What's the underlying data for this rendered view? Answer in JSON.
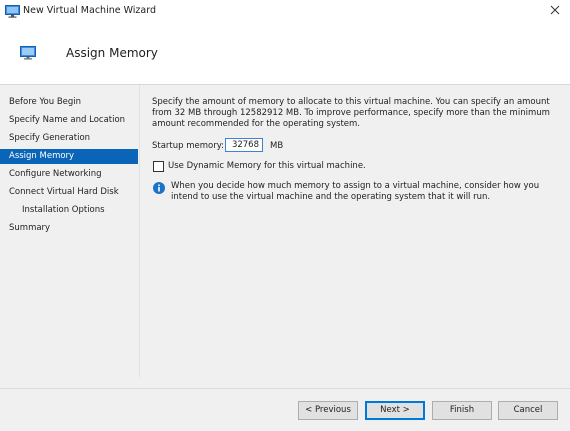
{
  "window": {
    "title": "New Virtual Machine Wizard"
  },
  "header": {
    "title": "Assign Memory"
  },
  "nav": {
    "items": [
      {
        "label": "Before You Begin"
      },
      {
        "label": "Specify Name and Location"
      },
      {
        "label": "Specify Generation"
      },
      {
        "label": "Assign Memory",
        "active": true
      },
      {
        "label": "Configure Networking"
      },
      {
        "label": "Connect Virtual Hard Disk"
      },
      {
        "label": "Installation Options",
        "indent": true
      },
      {
        "label": "Summary"
      }
    ]
  },
  "content": {
    "description": "Specify the amount of memory to allocate to this virtual machine. You can specify an amount from 32 MB through 12582912 MB. To improve performance, specify more than the minimum amount recommended for the operating system.",
    "startup_label": "Startup memory:",
    "startup_value": "32768",
    "startup_unit": "MB",
    "dynamic_label": "Use Dynamic Memory for this virtual machine.",
    "dynamic_checked": false,
    "info_text": "When you decide how much memory to assign to a virtual machine, consider how you intend to use the virtual machine and the operating system that it will run."
  },
  "buttons": {
    "previous": "< Previous",
    "next": "Next >",
    "finish": "Finish",
    "cancel": "Cancel"
  },
  "colors": {
    "accent": "#0a65b8",
    "info": "#1a73c8"
  },
  "icons": {
    "app": "hyper-v-monitor-icon",
    "close": "close-icon",
    "info": "info-icon"
  }
}
